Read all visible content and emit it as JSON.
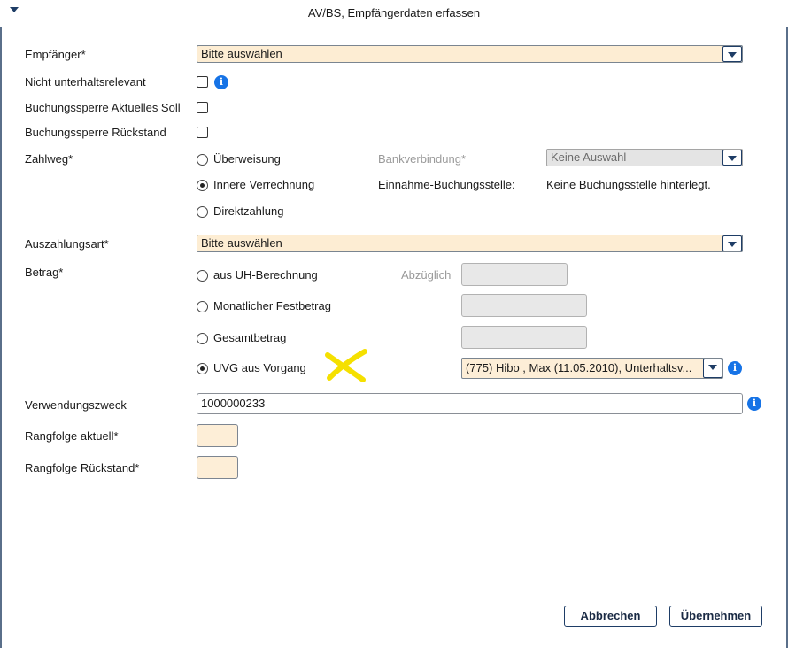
{
  "window": {
    "title": "AV/BS, Empfängerdaten erfassen"
  },
  "fields": {
    "empfaenger": {
      "label": "Empfänger*",
      "value": "Bitte auswählen"
    },
    "nicht_unterhaltsrelevant": {
      "label": "Nicht unterhaltsrelevant",
      "checked": false
    },
    "sperre_soll": {
      "label": "Buchungssperre Aktuelles Soll",
      "checked": false
    },
    "sperre_rueckstand": {
      "label": "Buchungssperre Rückstand",
      "checked": false
    },
    "zahlweg": {
      "label": "Zahlweg*",
      "options": [
        "Überweisung",
        "Innere Verrechnung",
        "Direktzahlung"
      ],
      "selected": "Innere Verrechnung",
      "bank_label": "Bankverbindung*",
      "bank_value": "Keine Auswahl",
      "einnahme_label": "Einnahme-Buchungsstelle:",
      "einnahme_value": "Keine Buchungsstelle hinterlegt."
    },
    "auszahlungsart": {
      "label": "Auszahlungsart*",
      "value": "Bitte auswählen"
    },
    "betrag": {
      "label": "Betrag*",
      "options": [
        "aus UH-Berechnung",
        "Monatlicher Festbetrag",
        "Gesamtbetrag",
        "UVG aus Vorgang"
      ],
      "selected": "UVG aus Vorgang",
      "abzueglich_label": "Abzüglich",
      "vorgang_value": "(775) Hibo , Max (11.05.2010), Unterhaltsv..."
    },
    "verwendungszweck": {
      "label": "Verwendungszweck",
      "value": "1000000233"
    },
    "rangfolge_aktuell": {
      "label": "Rangfolge aktuell*",
      "value": ""
    },
    "rangfolge_rueckstand": {
      "label": "Rangfolge Rückstand*",
      "value": ""
    }
  },
  "buttons": {
    "cancel": {
      "mnemonic": "A",
      "rest": "bbrechen"
    },
    "apply": {
      "pre": "Üb",
      "mnemonic": "e",
      "rest": "rnehmen"
    }
  },
  "icons": {
    "info": "info-icon",
    "dropdown": "chevron-down-icon",
    "menu": "menu-triangle-icon"
  },
  "colors": {
    "required_field_bg": "#fdedd3",
    "info_blue": "#1673e6",
    "accent_navy": "#1e3d66",
    "annotation_mark": "#f5e000"
  }
}
